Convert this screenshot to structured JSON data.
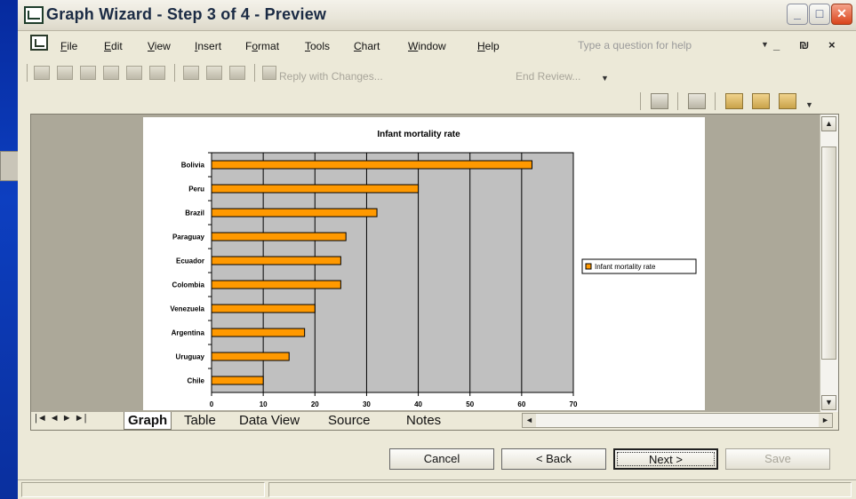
{
  "window": {
    "title": "Graph Wizard - Step 3 of 4 - Preview",
    "buttons": {
      "minimize": "_",
      "maximize": "□",
      "close": "✕"
    }
  },
  "menubar": {
    "items": [
      {
        "label": "File",
        "key": "F",
        "rest": "ile"
      },
      {
        "label": "Edit",
        "key": "E",
        "rest": "dit"
      },
      {
        "label": "View",
        "key": "V",
        "rest": "iew"
      },
      {
        "label": "Insert",
        "key": "I",
        "rest": "nsert"
      },
      {
        "label": "Format",
        "pre": "F",
        "key": "o",
        "rest": "rmat"
      },
      {
        "label": "Tools",
        "key": "T",
        "rest": "ools"
      },
      {
        "label": "Chart",
        "key": "C",
        "rest": "hart"
      },
      {
        "label": "Window",
        "key": "W",
        "rest": "indow"
      },
      {
        "label": "Help",
        "key": "H",
        "rest": "elp"
      }
    ],
    "help_placeholder": "Type a question for help",
    "mdi_controls": "_ ₪ ×"
  },
  "toolbar": {
    "reply_label": "Reply with Changes...",
    "end_review_label": "End Review..."
  },
  "chart_data": {
    "type": "bar",
    "orientation": "horizontal",
    "title": "Infant mortality rate",
    "categories": [
      "Bolivia",
      "Peru",
      "Brazil",
      "Paraguay",
      "Ecuador",
      "Colombia",
      "Venezuela",
      "Argentina",
      "Uruguay",
      "Chile"
    ],
    "series": [
      {
        "name": "Infant mortality rate",
        "values": [
          62,
          40,
          32,
          26,
          25,
          25,
          20,
          18,
          15,
          10
        ],
        "color": "#ff9900"
      }
    ],
    "xlim": [
      0,
      70
    ],
    "xticks": [
      "0",
      "10",
      "20",
      "30",
      "40",
      "50",
      "60",
      "70"
    ],
    "grid": true,
    "plot_bg": "#c0c0c0",
    "legend_position": "right"
  },
  "tabs": [
    "Graph",
    "Table",
    "Data View",
    "Source",
    "Notes"
  ],
  "tab_nav": "|◄ ◄ ► ►|",
  "dialog_buttons": {
    "cancel": "Cancel",
    "back": "< Back",
    "next": "Next >",
    "save": "Save"
  }
}
